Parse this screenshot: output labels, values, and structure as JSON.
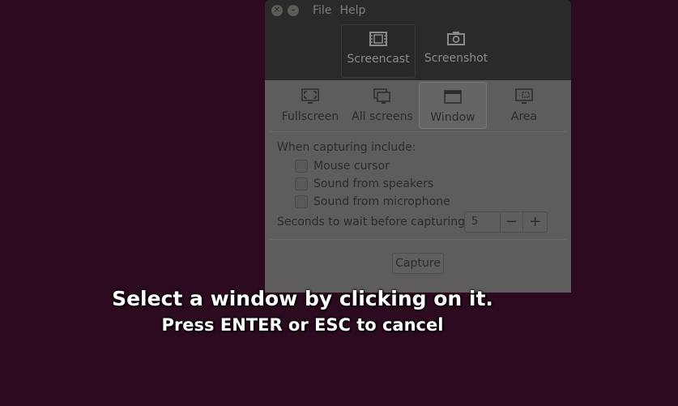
{
  "menubar": {
    "file": "File",
    "help": "Help"
  },
  "window_controls": {
    "close": "✕",
    "minimize": "–"
  },
  "modes": [
    {
      "label": "Screencast",
      "icon": "film-icon",
      "active": true
    },
    {
      "label": "Screenshot",
      "icon": "camera-icon",
      "active": false
    }
  ],
  "sources": [
    {
      "label": "Fullscreen",
      "icon": "fullscreen-icon",
      "active": false
    },
    {
      "label": "All screens",
      "icon": "all-screens-icon",
      "active": false
    },
    {
      "label": "Window",
      "icon": "window-icon",
      "active": true
    },
    {
      "label": "Area",
      "icon": "area-icon",
      "active": false
    }
  ],
  "options": {
    "heading": "When capturing include:",
    "mouse_cursor": "Mouse cursor",
    "sound_speakers": "Sound from speakers",
    "sound_microphone": "Sound from microphone"
  },
  "delay": {
    "label": "Seconds to wait before capturing:",
    "value": "5",
    "minus": "−",
    "plus": "+"
  },
  "capture_label": "Capture",
  "overlay": {
    "title": "Select a window by clicking on it.",
    "subtitle": "Press ENTER or ESC to cancel"
  },
  "colors": {
    "desktop": "#2c0a1f",
    "titlebar": "#2b2a28",
    "panel": "#5e5d5b"
  }
}
